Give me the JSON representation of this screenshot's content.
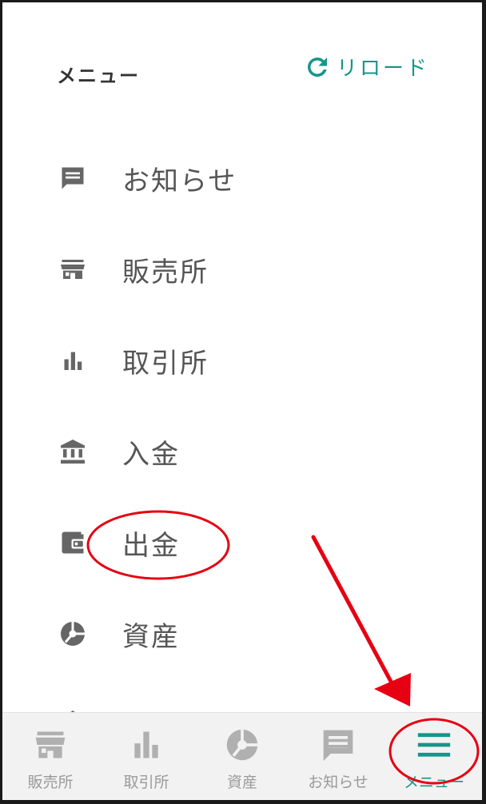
{
  "header": {
    "title": "メニュー",
    "reload_label": "リロード"
  },
  "menu": {
    "items": [
      {
        "label": "お知らせ",
        "icon": "message-icon"
      },
      {
        "label": "販売所",
        "icon": "store-icon"
      },
      {
        "label": "取引所",
        "icon": "bar-chart-icon"
      },
      {
        "label": "入金",
        "icon": "bank-icon"
      },
      {
        "label": "出金",
        "icon": "wallet-icon"
      },
      {
        "label": "資産",
        "icon": "pie-chart-icon"
      }
    ]
  },
  "tabbar": {
    "tabs": [
      {
        "label": "販売所",
        "icon": "store-icon",
        "active": false
      },
      {
        "label": "取引所",
        "icon": "bar-chart-icon",
        "active": false
      },
      {
        "label": "資産",
        "icon": "pie-chart-icon",
        "active": false
      },
      {
        "label": "お知らせ",
        "icon": "message-icon",
        "active": false
      },
      {
        "label": "メニュー",
        "icon": "hamburger-icon",
        "active": true
      }
    ]
  },
  "colors": {
    "accent": "#15968a",
    "icon_gray": "#666666",
    "tab_inactive": "#b0b0b0",
    "annotation_red": "#e60012"
  }
}
